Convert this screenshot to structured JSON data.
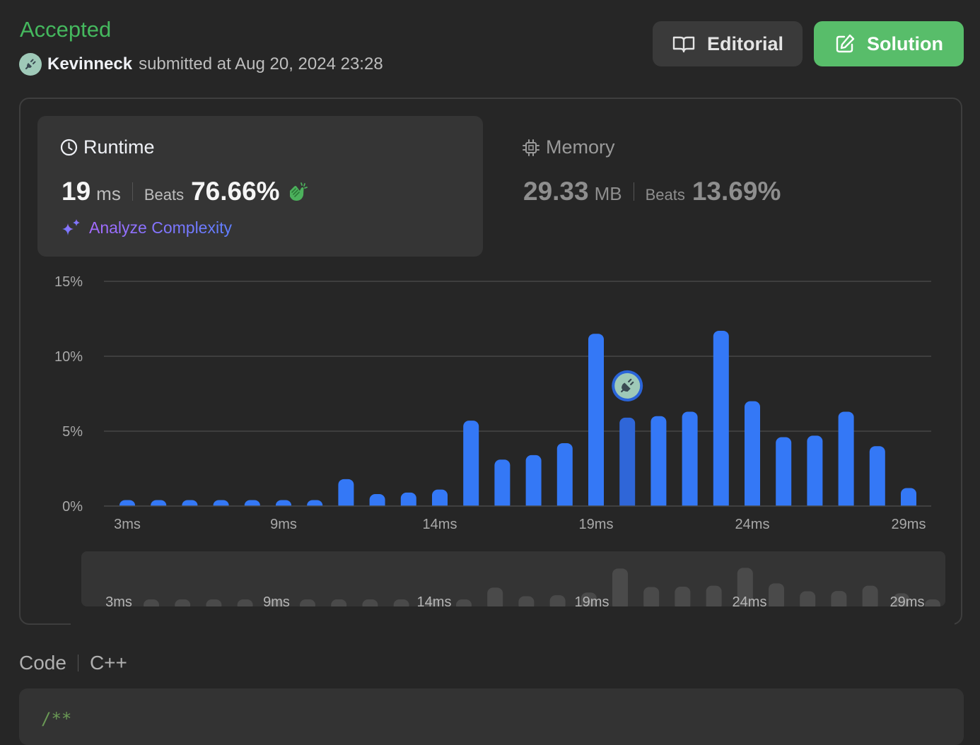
{
  "header": {
    "status": "Accepted",
    "username": "Kevinneck",
    "submitted_text": "submitted at Aug 20, 2024 23:28",
    "editorial_label": "Editorial",
    "solution_label": "Solution"
  },
  "runtime": {
    "title": "Runtime",
    "value": "19",
    "unit": "ms",
    "beats_label": "Beats",
    "beats_pct": "76.66%",
    "analyze_label": "Analyze Complexity"
  },
  "memory": {
    "title": "Memory",
    "value": "29.33",
    "unit": "MB",
    "beats_label": "Beats",
    "beats_pct": "13.69%"
  },
  "colors": {
    "accepted": "#45b85e",
    "bar": "#3478f6",
    "bar_selected": "#2f66d8",
    "mini_bar": "#4a4a4a",
    "solution_button": "#58bd6a"
  },
  "chart_data": {
    "type": "bar",
    "ylim": [
      0,
      15
    ],
    "y_ticks": [
      "0%",
      "5%",
      "10%",
      "15%"
    ],
    "x": [
      3,
      4,
      5,
      6,
      7,
      8,
      9,
      10,
      11,
      12,
      13,
      14,
      15,
      16,
      17,
      18,
      19,
      20,
      21,
      22,
      23,
      24,
      25,
      26,
      27,
      28,
      29
    ],
    "values": [
      0.4,
      0.4,
      0.4,
      0.4,
      0.4,
      0.4,
      0.4,
      1.8,
      0.8,
      0.9,
      1.1,
      5.7,
      3.1,
      3.4,
      4.2,
      11.5,
      5.9,
      6.0,
      6.3,
      11.7,
      7.0,
      4.6,
      4.7,
      6.3,
      4.0,
      1.2
    ],
    "x_tick_labels": [
      "3ms",
      "9ms",
      "14ms",
      "19ms",
      "24ms",
      "29ms"
    ],
    "selected_x": 19,
    "mini_labels": [
      "3ms",
      "9ms",
      "14ms",
      "19ms",
      "24ms",
      "29ms"
    ]
  },
  "code": {
    "label": "Code",
    "language": "C++",
    "first_line": "/**"
  }
}
